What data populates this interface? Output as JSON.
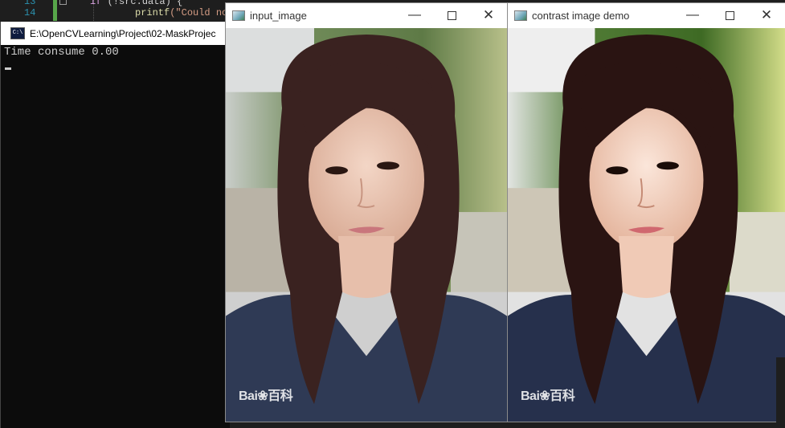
{
  "editor": {
    "line_numbers": [
      "13",
      "14"
    ],
    "line1_kw": "if",
    "line1_code": " (!src.data) {",
    "line2_fn": "printf",
    "line2_str": "(\"Could no"
  },
  "console": {
    "title": "E:\\OpenCVLearning\\Project\\02-MaskProjec",
    "icon": "C:\\",
    "output": "Time consume 0.00"
  },
  "windows": [
    {
      "title": "input_image",
      "watermark": "Bai❀百科",
      "contrast": "normal"
    },
    {
      "title": "contrast image demo",
      "watermark": "Bai❀百科",
      "contrast": "enhanced"
    }
  ],
  "controls": {
    "minimize": "—",
    "close": "✕"
  }
}
